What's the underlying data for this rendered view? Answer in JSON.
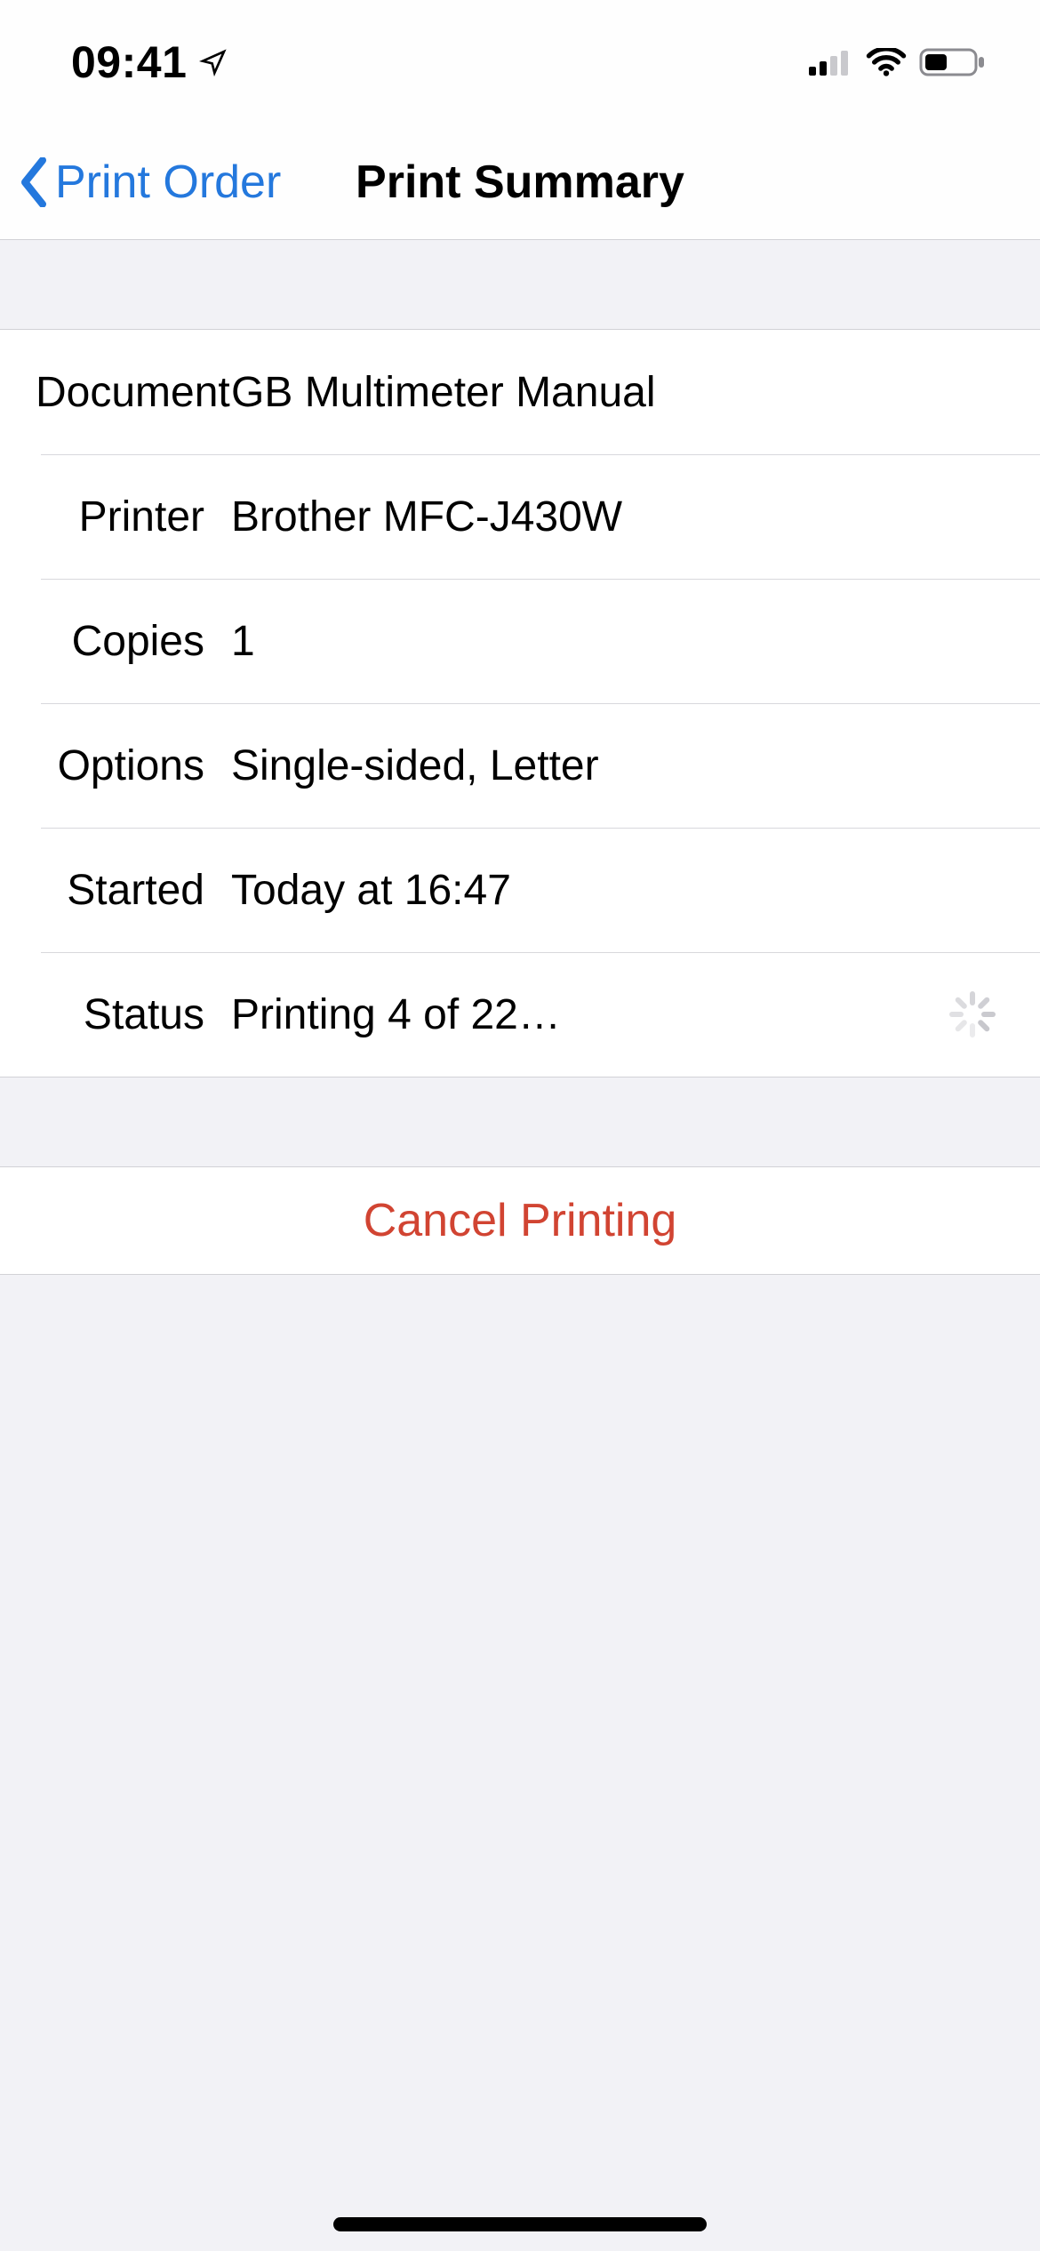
{
  "statusbar": {
    "time": "09:41"
  },
  "nav": {
    "back_label": "Print Order",
    "title": "Print Summary"
  },
  "details": {
    "document": {
      "label": "Document",
      "value": "GB Multimeter Manual"
    },
    "printer": {
      "label": "Printer",
      "value": "Brother MFC-J430W"
    },
    "copies": {
      "label": "Copies",
      "value": "1"
    },
    "options": {
      "label": "Options",
      "value": "Single-sided, Letter"
    },
    "started": {
      "label": "Started",
      "value": "Today at 16:47"
    },
    "status": {
      "label": "Status",
      "value": "Printing 4 of 22…"
    }
  },
  "actions": {
    "cancel_label": "Cancel Printing"
  }
}
